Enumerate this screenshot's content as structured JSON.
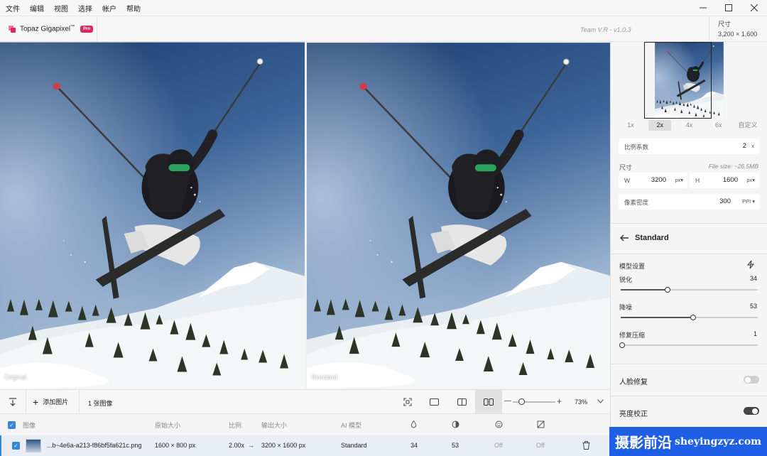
{
  "menubar": {
    "items": [
      "文件",
      "编辑",
      "视图",
      "选择",
      "帐户",
      "帮助"
    ]
  },
  "window_controls": {
    "minimize_icon": "minimize-icon",
    "maximize_icon": "maximize-icon",
    "close_icon": "close-icon"
  },
  "header": {
    "app_name": "Topaz Gigapixel",
    "app_name_suffix": "™",
    "badge": "Pro",
    "version": "Team V.R - v1.0.3",
    "dims_label": "尺寸",
    "dims_value": "3,200 × 1,600"
  },
  "preview": {
    "left_label": "Original",
    "right_label": "Standard"
  },
  "panel": {
    "scale_tabs": [
      "1x",
      "2x",
      "4x",
      "6x",
      "自定义"
    ],
    "active_scale": "2x",
    "scale_factor_label": "比例系数",
    "scale_factor_value": "2",
    "scale_factor_unit": "x",
    "size_label": "尺寸",
    "file_size": "File size: ~26.5MB",
    "width_label": "W",
    "width_value": "3200",
    "width_unit": "px▾",
    "height_label": "H",
    "height_value": "1600",
    "height_unit": "px▾",
    "density_label": "像素密度",
    "density_value": "300",
    "density_unit": "PPI ▾",
    "model_back_icon": "arrow-left-icon",
    "model_name": "Standard",
    "model_settings_label": "模型设置",
    "sliders": [
      {
        "label": "锐化",
        "value": "34",
        "level": 0.34
      },
      {
        "label": "降噪",
        "value": "53",
        "level": 0.53
      },
      {
        "label": "修复压缩",
        "value": "1",
        "level": 0.01
      }
    ],
    "face_recovery_label": "人脸修复",
    "face_recovery_on": false,
    "brightness_label": "亮度校正",
    "brightness_on": true
  },
  "toolbar": {
    "add_image_label": "添加图片",
    "image_count": "1 张图像",
    "zoom_minus": "—",
    "zoom_plus": "+",
    "zoom_level": "73%",
    "zoom_fraction": 0.2
  },
  "table": {
    "headers": [
      "图像",
      "原始大小",
      "比例",
      "输出大小",
      "AI 模型"
    ],
    "row": {
      "filename": "...b~4e6a-a213-f86bf5fa621c.png",
      "original_size": "1600 × 800 px",
      "scale": "2.00x",
      "arrow": "→",
      "output_size": "3200 × 1600 px",
      "model": "Standard",
      "sharpen": "34",
      "denoise": "53",
      "face": "Off",
      "brightness": "Off"
    }
  },
  "watermark": {
    "cn": "摄影前沿",
    "url": "sheyingzyz.com"
  },
  "colors": {
    "accent": "#3a86d6",
    "brand": "#e0245e",
    "watermark": "#1f5fe6"
  }
}
